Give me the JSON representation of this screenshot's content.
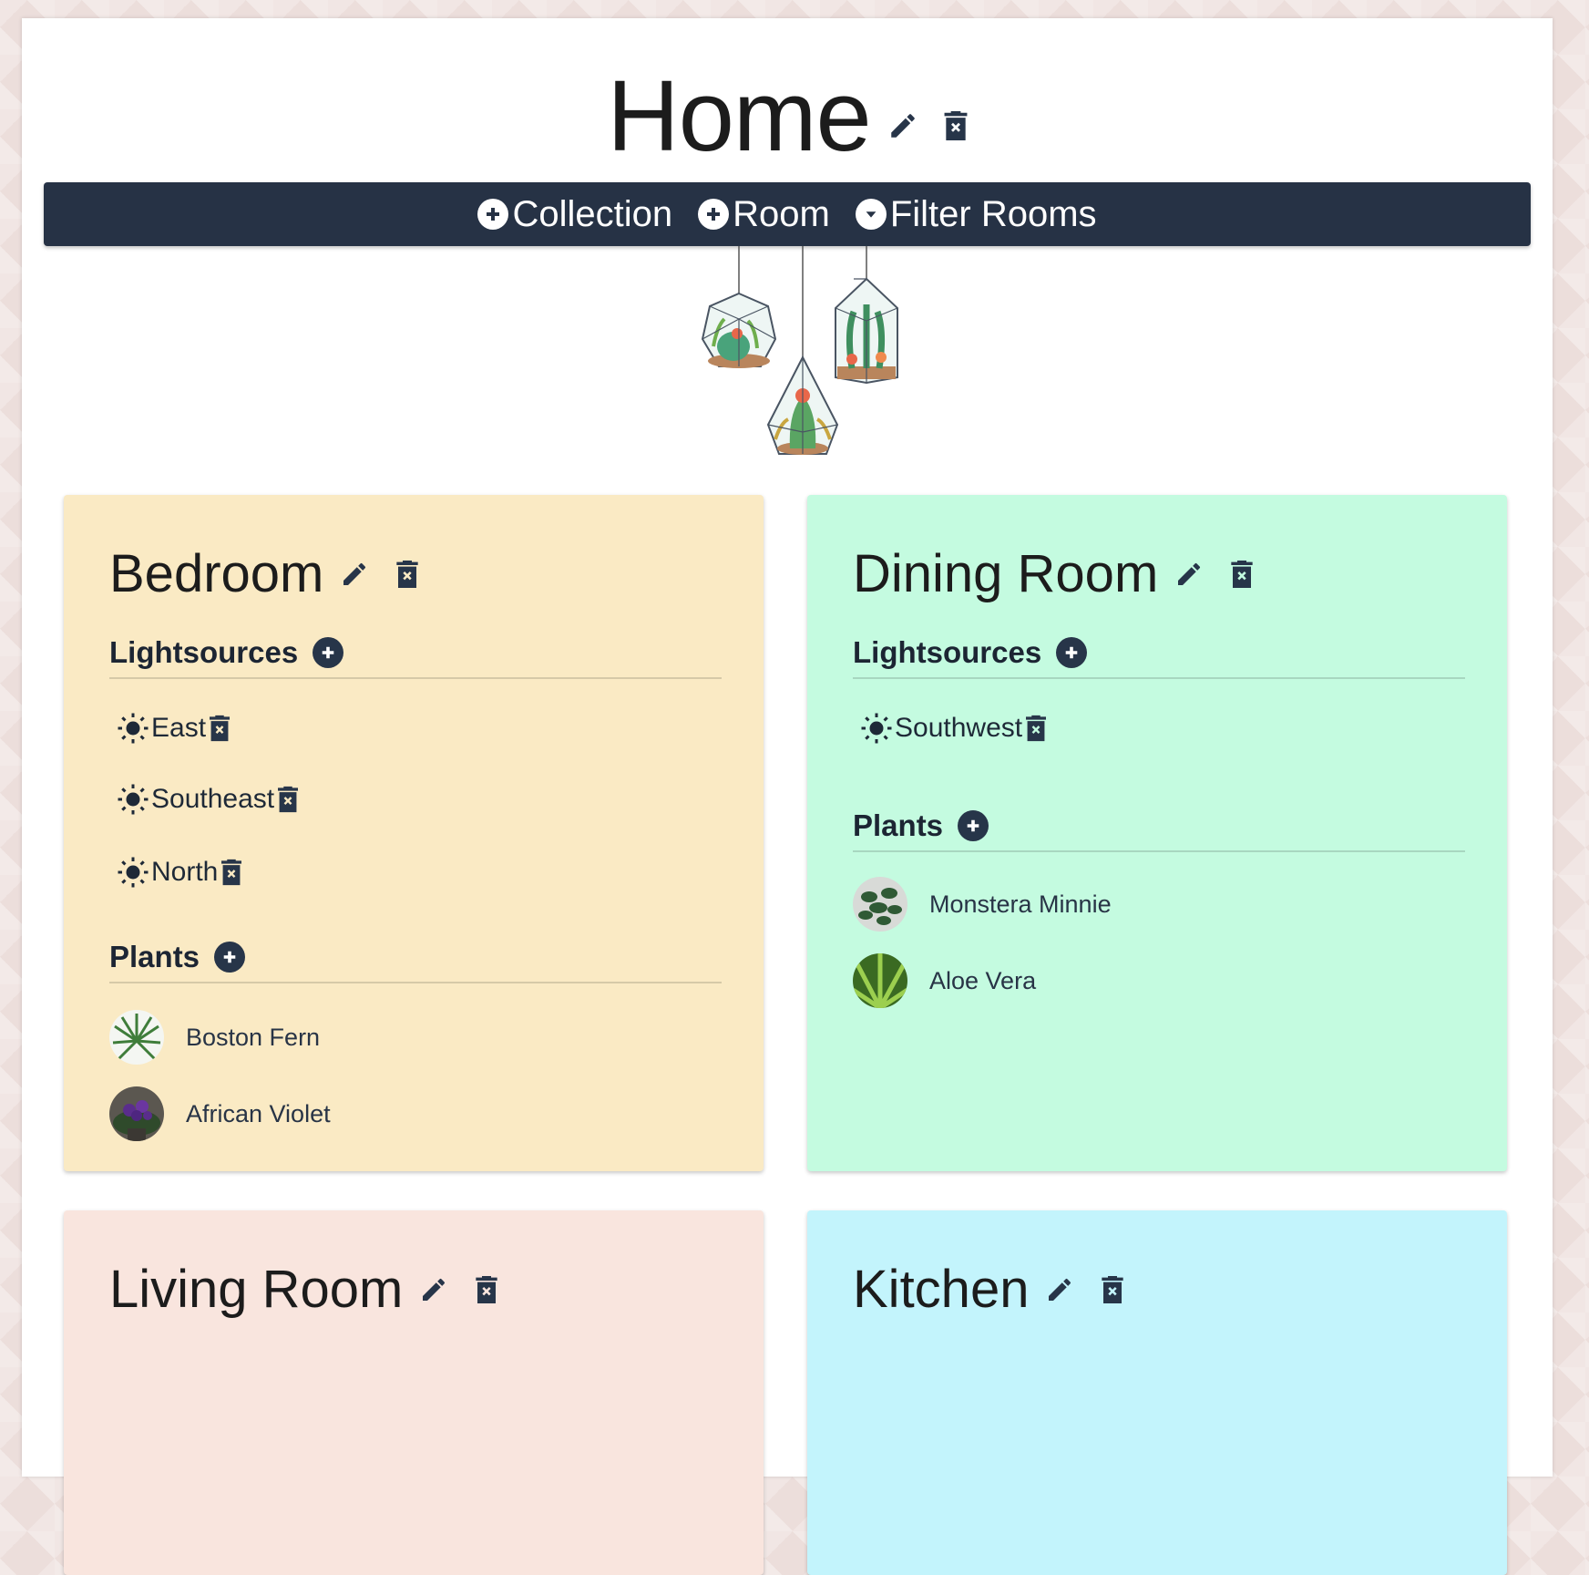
{
  "home": {
    "title": "Home"
  },
  "toolbar": {
    "collection_label": "Collection",
    "room_label": "Room",
    "filter_label": "Filter Rooms"
  },
  "rooms": [
    {
      "name": "Bedroom",
      "color": "#faeac4",
      "lightsources_label": "Lightsources",
      "lightsources": [
        "East",
        "Southeast",
        "North"
      ],
      "plants_label": "Plants",
      "plants": [
        "Boston Fern",
        "African Violet"
      ]
    },
    {
      "name": "Dining Room",
      "color": "#c4fbe0",
      "lightsources_label": "Lightsources",
      "lightsources": [
        "Southwest"
      ],
      "plants_label": "Plants",
      "plants": [
        "Monstera Minnie",
        "Aloe Vera"
      ]
    },
    {
      "name": "Living Room",
      "color": "#f9e5de"
    },
    {
      "name": "Kitchen",
      "color": "#c3f4fc"
    }
  ],
  "icons": {
    "edit": "pencil-icon",
    "delete": "trash-icon",
    "add": "plus-circle-icon",
    "filter": "chevron-down-circle-icon",
    "light": "sun-icon"
  },
  "colors": {
    "navbar": "#263245",
    "accent": "#273549"
  }
}
